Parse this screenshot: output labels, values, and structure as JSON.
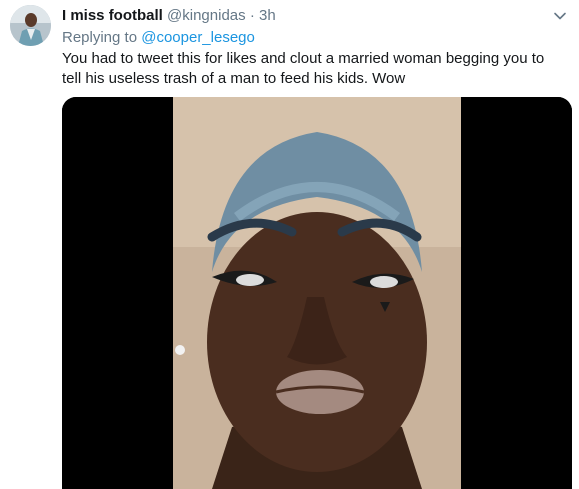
{
  "tweet": {
    "display_name": "I miss football",
    "handle": "@kingnidas",
    "separator": "·",
    "time": "3h",
    "replying_prefix": "Replying to",
    "replying_to": "@cooper_lesego",
    "text": "You had to tweet this for likes and clout a married woman begging you to tell his useless trash of a man  to feed his kids. Wow"
  },
  "colors": {
    "accent": "#1b95e0",
    "secondary_text": "#657786",
    "primary_text": "#14171a"
  },
  "icons": {
    "menu": "chevron-down-icon"
  }
}
